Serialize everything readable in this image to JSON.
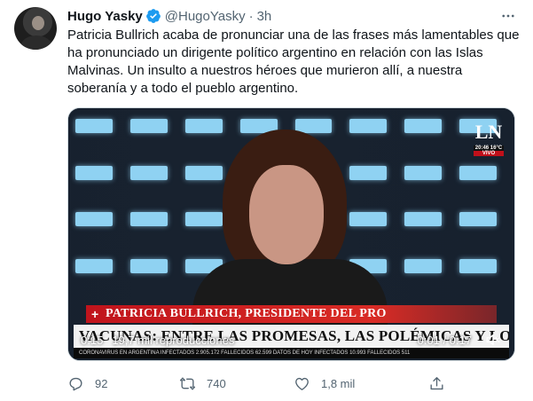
{
  "tweet": {
    "author_name": "Hugo Yasky",
    "handle": "@HugoYasky",
    "separator": "·",
    "time": "3h",
    "text": "Patricia Bullrich acaba de pronunciar una de las frases más lamentables que ha pronunciado un dirigente político argentino en relación con las Islas Malvinas. Un insulto a nuestros héroes que murieron allí, a nuestra soberanía y a todo el pueblo argentino.",
    "more_icon": "more-horizontal-icon",
    "verified_icon": "verified-badge-icon"
  },
  "video": {
    "channel_logo": "LN",
    "channel_time": "20:46 16°C",
    "channel_live": "VIVO",
    "lower_third_name": "PATRICIA BULLRICH, PRESIDENTE DEL PRO",
    "lower_third_headline": "VACUNAS: ENTRE LAS PROMESAS, LAS POLÉMICAS Y LOS ERRORES",
    "ticker": "CORONAVIRUS EN ARGENTINA   INFECTADOS 2.905.172   FALLECIDOS 62.599   DATOS DE HOY   INFECTADOS 10.993   FALLECIDOS 511",
    "elapsed": "0:15",
    "views": "19,7 mil reproducciones",
    "time_display": "0:01 / 0:17",
    "mute_icon": "speaker-muted-icon"
  },
  "actions": {
    "reply_count": "92",
    "retweet_count": "740",
    "like_count": "1,8 mil",
    "reply_icon": "reply-icon",
    "retweet_icon": "retweet-icon",
    "like_icon": "heart-icon",
    "share_icon": "share-icon"
  },
  "colors": {
    "text_primary": "#0f1419",
    "text_secondary": "#536471",
    "verified_blue": "#1d9bf0",
    "lower_third_red": "#c0141c"
  }
}
